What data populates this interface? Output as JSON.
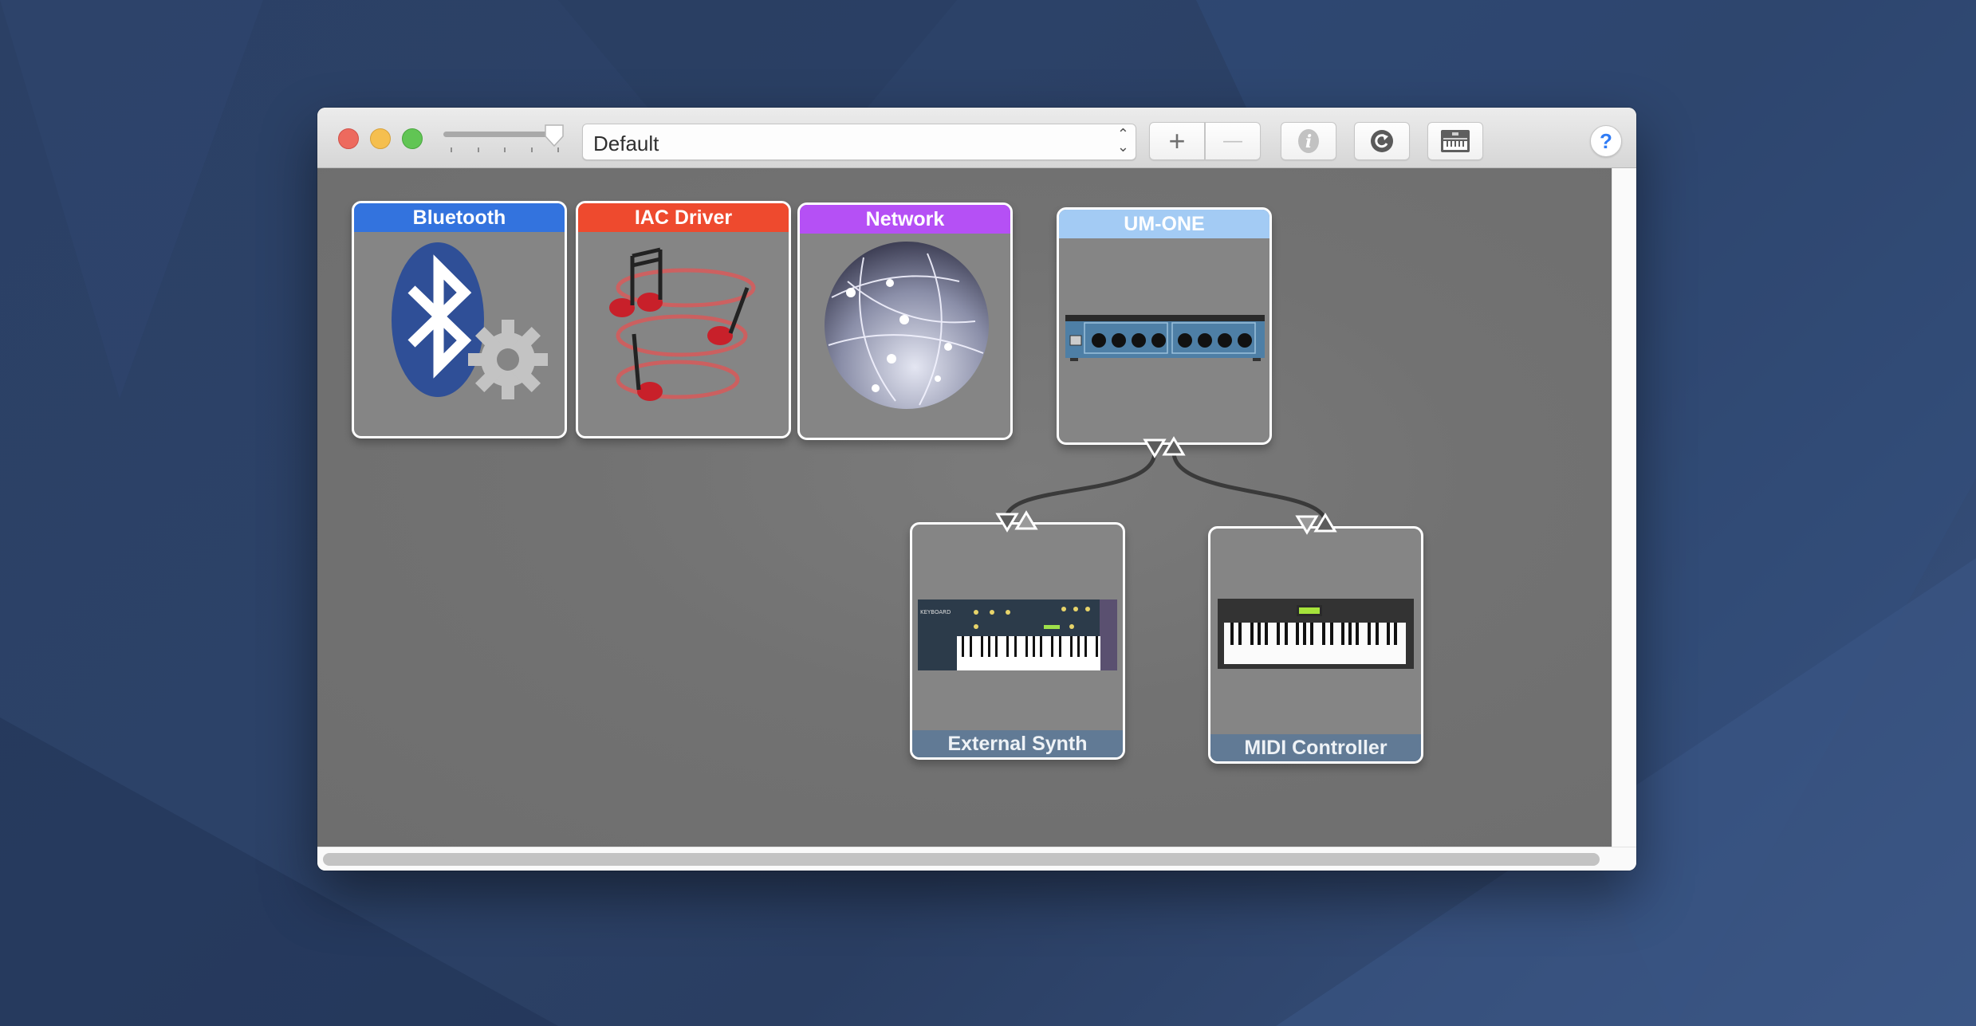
{
  "window": {
    "controls": [
      "close",
      "minimize",
      "zoom"
    ],
    "icon_size_slider": {
      "value_fraction": 1.0,
      "ticks": 5
    },
    "configuration": {
      "selected": "Default"
    },
    "toolbar": {
      "add_label": "+",
      "remove_label": "—",
      "info_icon": "info-icon",
      "rescan_icon": "rescan-icon",
      "test_setup_icon": "keyboard-icon",
      "help_label": "?"
    }
  },
  "devices": [
    {
      "name": "Bluetooth",
      "header_color": "#3373de",
      "icon": "bluetooth-icon"
    },
    {
      "name": "IAC Driver",
      "header_color": "#ee4a2e",
      "icon": "music-notes-icon"
    },
    {
      "name": "Network",
      "header_color": "#b550f5",
      "icon": "network-globe-icon"
    },
    {
      "name": "UM-ONE",
      "header_color": "#a3cbf4",
      "icon": "midi-interface-icon"
    },
    {
      "name": "External Synth",
      "footer_color": "#617a95",
      "icon": "synth-keyboard-icon"
    },
    {
      "name": "MIDI Controller",
      "footer_color": "#617a95",
      "icon": "midi-controller-icon"
    }
  ],
  "connections": [
    {
      "from": "UM-ONE",
      "to": "External Synth"
    },
    {
      "from": "UM-ONE",
      "to": "MIDI Controller"
    }
  ]
}
